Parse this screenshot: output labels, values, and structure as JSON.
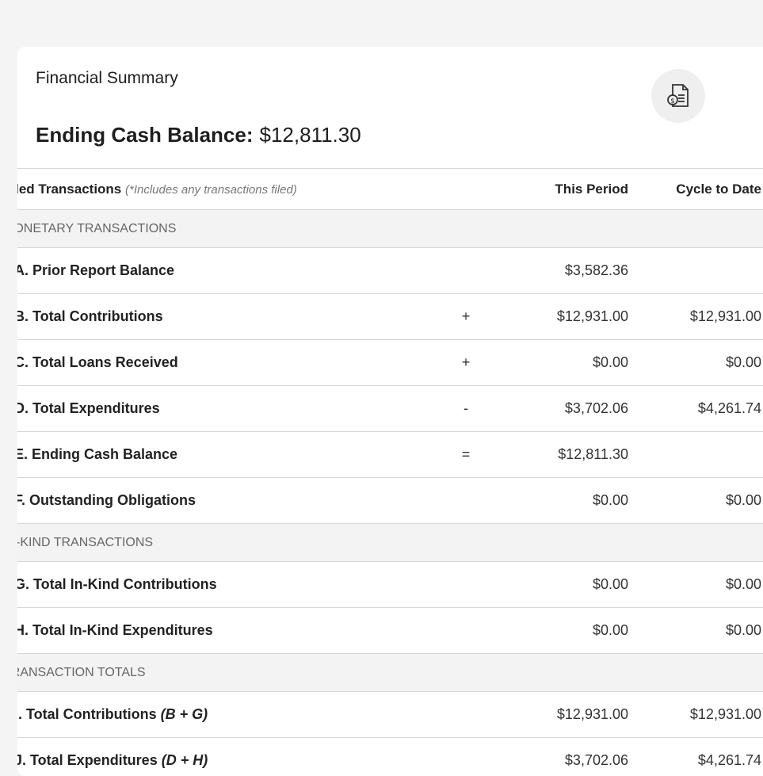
{
  "card": {
    "title": "Financial Summary",
    "balance_label": "Ending Cash Balance:",
    "balance_value": "$12,811.30",
    "icon": "document-dollar-icon"
  },
  "table": {
    "header": {
      "description": "Filed Transactions",
      "note": "(*Includes any transactions filed)",
      "this_period": "This Period",
      "cycle_to_date": "Cycle to Date"
    },
    "sections": [
      {
        "title": "MONETARY TRANSACTIONS",
        "rows": [
          {
            "label": "A. Prior Report Balance",
            "op": "",
            "this_period": "$3,582.36",
            "cycle_to_date": ""
          },
          {
            "label": "B. Total Contributions",
            "op": "+",
            "this_period": "$12,931.00",
            "cycle_to_date": "$12,931.00"
          },
          {
            "label": "C. Total Loans Received",
            "op": "+",
            "this_period": "$0.00",
            "cycle_to_date": "$0.00"
          },
          {
            "label": "D. Total Expenditures",
            "op": "-",
            "this_period": "$3,702.06",
            "cycle_to_date": "$4,261.74"
          },
          {
            "label": "E. Ending Cash Balance",
            "op": "=",
            "this_period": "$12,811.30",
            "cycle_to_date": ""
          },
          {
            "label": "F. Outstanding Obligations",
            "op": "",
            "this_period": "$0.00",
            "cycle_to_date": "$0.00"
          }
        ]
      },
      {
        "title": "IN-KIND TRANSACTIONS",
        "rows": [
          {
            "label": "G. Total In-Kind Contributions",
            "op": "",
            "this_period": "$0.00",
            "cycle_to_date": "$0.00"
          },
          {
            "label": "H. Total In-Kind Expenditures",
            "op": "",
            "this_period": "$0.00",
            "cycle_to_date": "$0.00"
          }
        ]
      },
      {
        "title": "TRANSACTION TOTALS",
        "rows": [
          {
            "label": "I. Total Contributions",
            "formula": "(B + G)",
            "op": "",
            "this_period": "$12,931.00",
            "cycle_to_date": "$12,931.00"
          },
          {
            "label": "J. Total Expenditures",
            "formula": "(D + H)",
            "op": "",
            "this_period": "$3,702.06",
            "cycle_to_date": "$4,261.74"
          }
        ]
      }
    ]
  }
}
